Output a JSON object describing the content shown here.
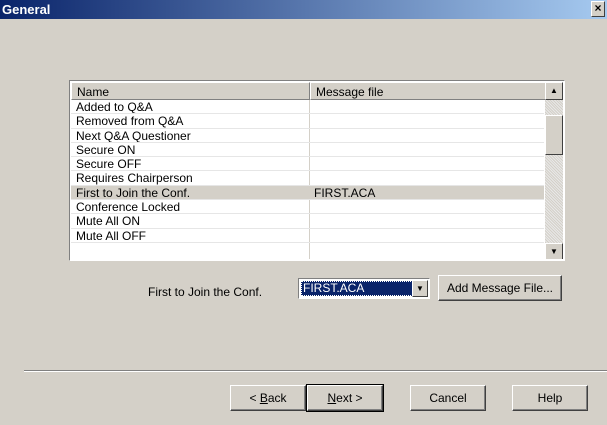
{
  "window": {
    "title": "General",
    "close_glyph": "×"
  },
  "table": {
    "columns": [
      "Name",
      "Message file"
    ],
    "rows": [
      {
        "name": "Added to Q&A",
        "file": ""
      },
      {
        "name": "Removed from Q&A",
        "file": ""
      },
      {
        "name": "Next Q&A Questioner",
        "file": ""
      },
      {
        "name": "Secure ON",
        "file": ""
      },
      {
        "name": "Secure OFF",
        "file": ""
      },
      {
        "name": "Requires Chairperson",
        "file": ""
      },
      {
        "name": "First to Join the Conf.",
        "file": "FIRST.ACA",
        "selected": true
      },
      {
        "name": "Conference Locked",
        "file": ""
      },
      {
        "name": "Mute All ON",
        "file": ""
      },
      {
        "name": "Mute All OFF",
        "file": ""
      }
    ],
    "scroll_up_glyph": "▲",
    "scroll_down_glyph": "▼"
  },
  "field": {
    "label": "First to Join the Conf.",
    "combo_value": "FIRST.ACA",
    "combo_arrow_glyph": "▼",
    "add_button": "Add Message File..."
  },
  "buttons": {
    "back_prefix": "< ",
    "back_accel": "B",
    "back_rest": "ack",
    "next_accel": "N",
    "next_rest": "ext >",
    "cancel": "Cancel",
    "help": "Help"
  },
  "colors": {
    "face": "#d4d0c8",
    "title_bar": "#0a246a",
    "selection": "#0a246a"
  }
}
